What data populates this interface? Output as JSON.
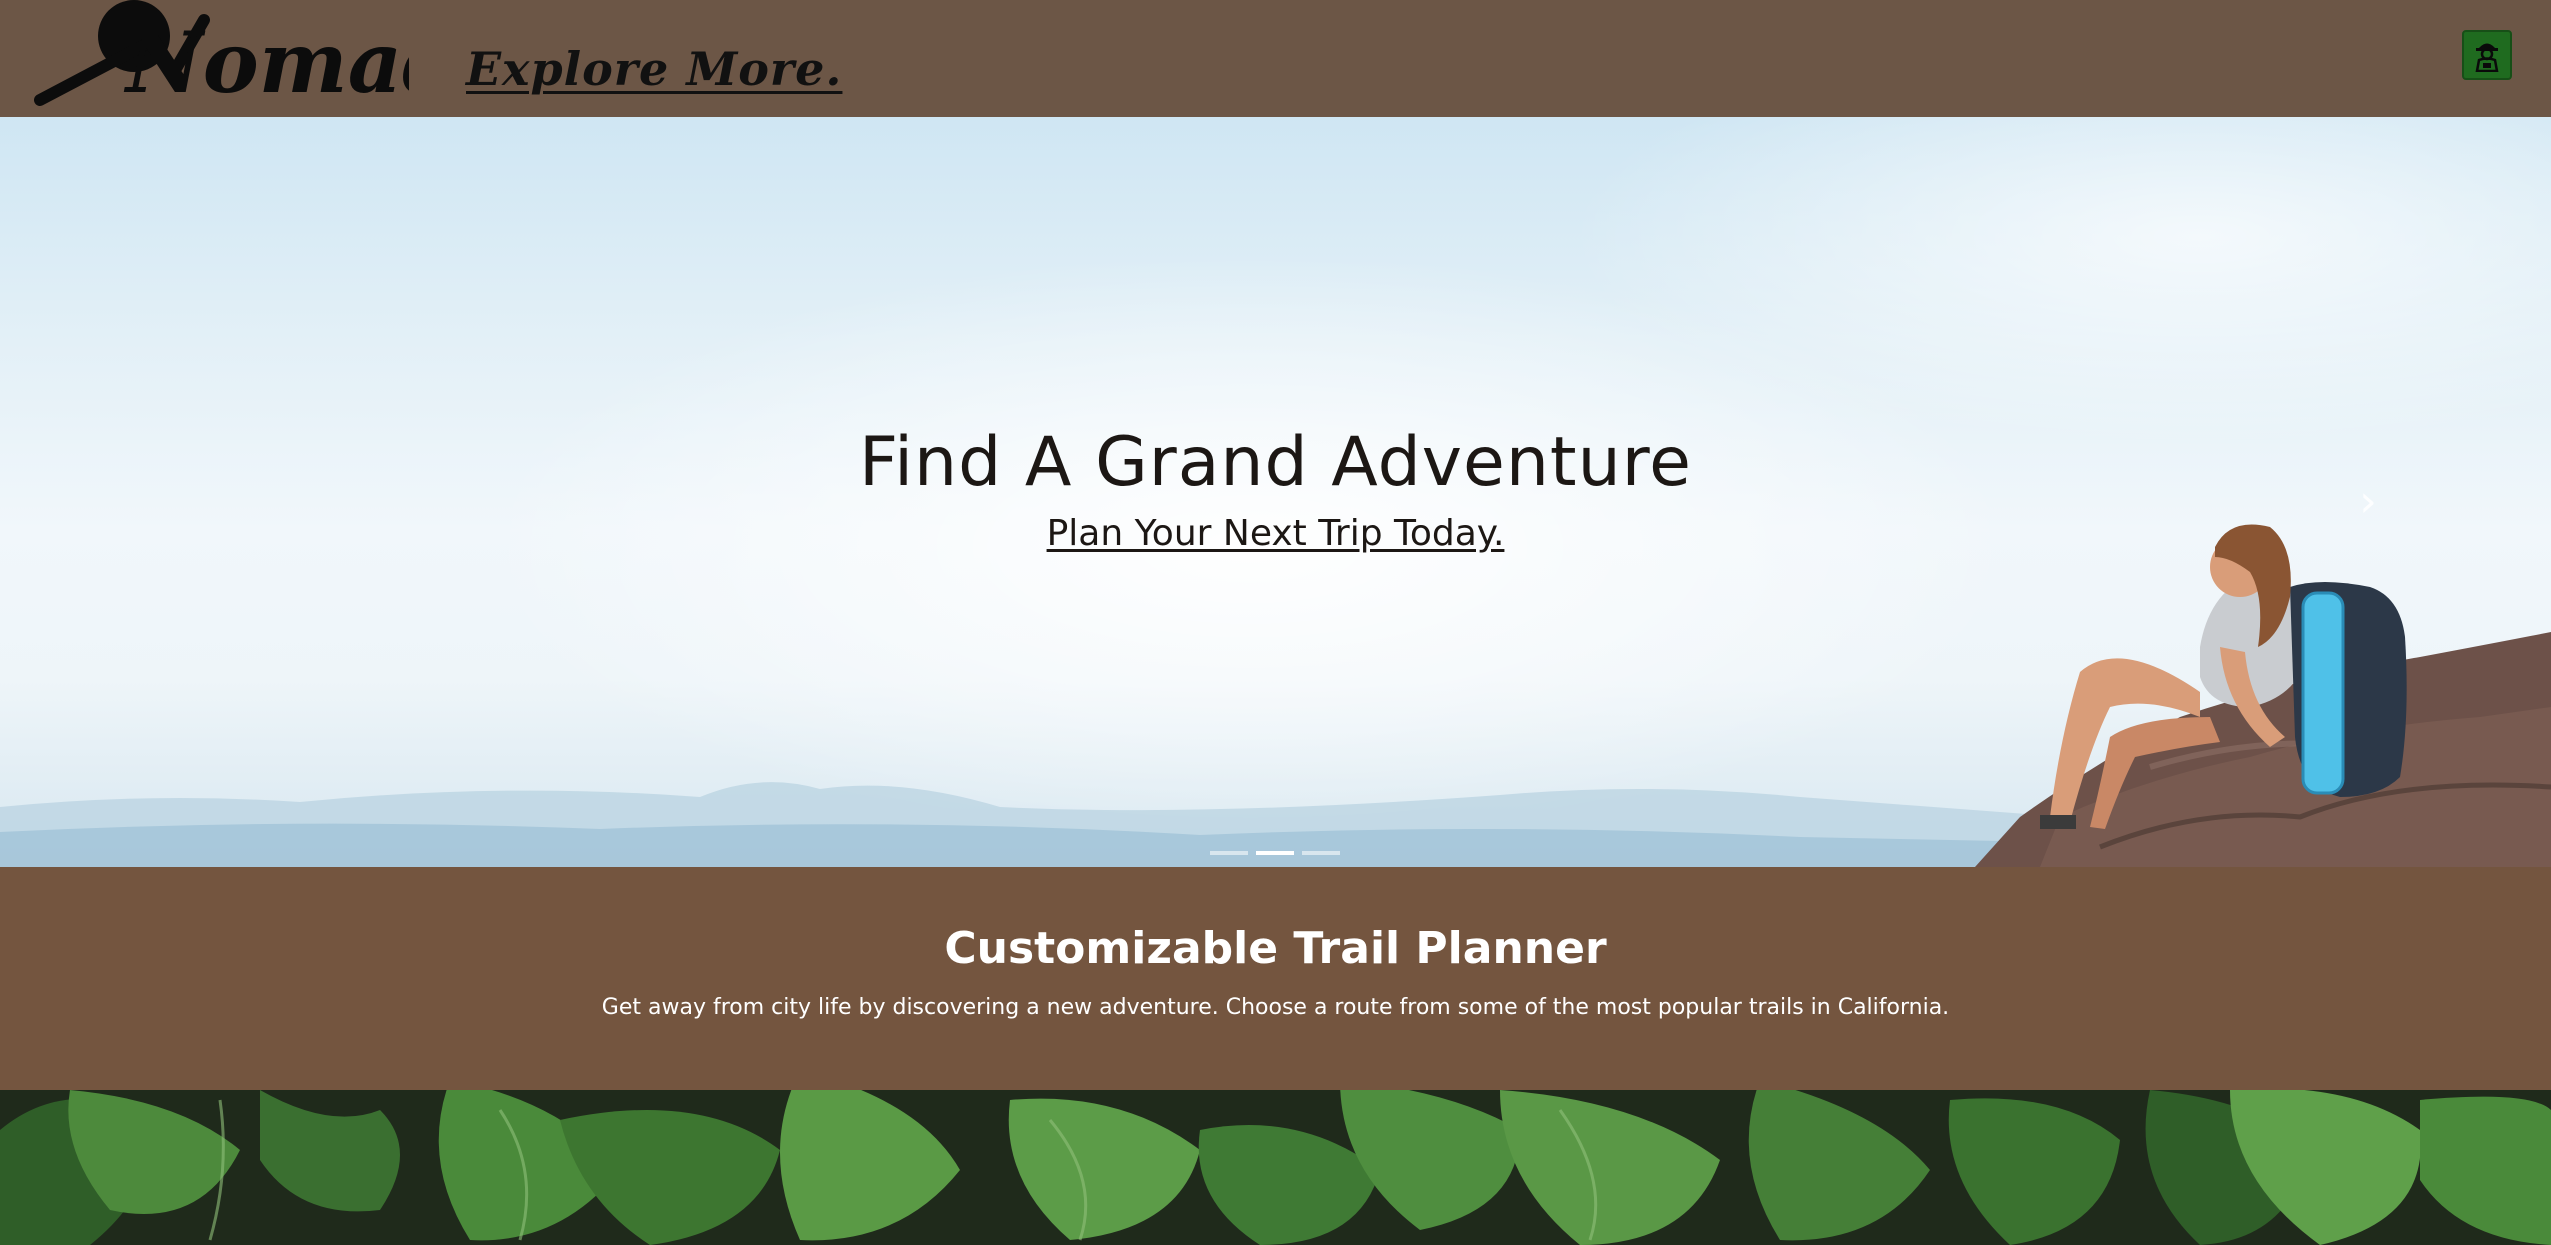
{
  "header": {
    "logo_text": "Nomad",
    "tagline": "Explore More.",
    "profile_icon": "hiker-icon"
  },
  "hero": {
    "title": "Find A Grand Adventure",
    "subtitle": "Plan Your Next Trip Today.",
    "next_icon": "chevron-right-icon",
    "next_symbol": "›",
    "slides": [
      {
        "active": false
      },
      {
        "active": true
      },
      {
        "active": false
      }
    ]
  },
  "planner": {
    "title": "Customizable Trail Planner",
    "description": "Get away from city life by discovering a new adventure. Choose a route from some of the most popular trails in California."
  },
  "colors": {
    "header_bg": "#6c5646",
    "planner_bg": "#74553f",
    "profile_button": "#1f6b1f"
  }
}
